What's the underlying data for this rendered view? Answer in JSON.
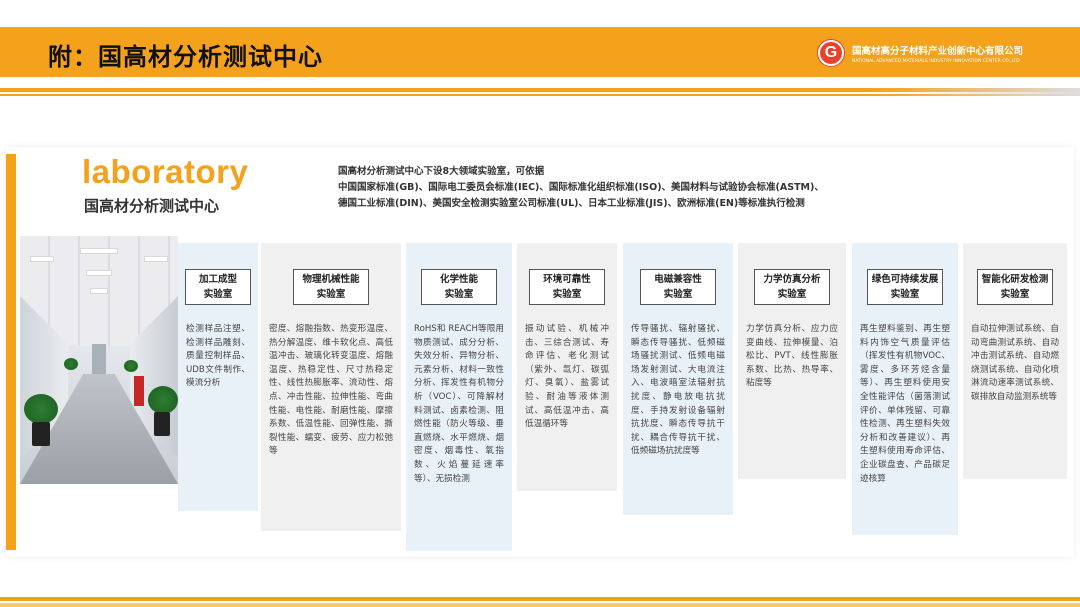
{
  "header": {
    "title": "附：国高材分析测试中心",
    "logo_letter": "G",
    "logo_cn": "国高材高分子材料产业创新中心有限公司",
    "logo_en": "NATIONAL ADVANCED MATERIALS INDUSTRY INNOVATION CENTER CO.,LTD"
  },
  "lab": {
    "heading": "laboratory",
    "subheading": "国高材分析测试中心"
  },
  "intro": {
    "line1": "国高材分析测试中心下设8大领域实验室，可依据",
    "line2": "中国国家标准(GB)、国际电工委员会标准(IEC)、国际标准化组织标准(ISO)、美国材料与试验协会标准(ASTM)、",
    "line3": "德国工业标准(DIN)、美国安全检测实验室公司标准(UL)、日本工业标准(JIS)、欧洲标准(EN)等标准执行检测"
  },
  "columns": [
    {
      "title1": "加工成型",
      "title2": "实验室",
      "body": "检测样品注塑、检测样品雕刻、质量控制样品、UDB文件制作、模流分析",
      "bg": "#e8f1f8"
    },
    {
      "title1": "物理机械性能",
      "title2": "实验室",
      "body": "密度、熔融指数、热变形温度、热分解温度、维卡软化点、高低温冲击、玻璃化转变温度、熔融温度、热稳定性、尺寸热稳定性、线性热膨胀率、流动性、熔点、冲击性能、拉伸性能、弯曲性能、电性能、耐磨性能、摩擦系数、低温性能、回弹性能、撕裂性能、蠕变、疲劳、应力松弛等",
      "bg": "#f0f0f0"
    },
    {
      "title1": "化学性能",
      "title2": "实验室",
      "body": "RoHS和 REACH等限用物质测试、成分分析、失效分析、异物分析、元素分析、材料一致性分析、挥发性有机物分析（VOC）、可降解材料测试、卤素检测、阻燃性能（防火等级、垂直燃烧、水平燃烧、烟密度、烟毒性、氧指数、火焰蔓延速率等）、无损检测",
      "bg": "#e8f1f8"
    },
    {
      "title1": "环境可靠性",
      "title2": "实验室",
      "body": "振动试验、机械冲击、三综合测试、寿命评估、老化测试（紫外、氙灯、碳弧灯、臭氧）、盐雾试验、耐油等液体测试、高低温冲击、高低温循环等",
      "bg": "#f0f0f0"
    },
    {
      "title1": "电磁兼容性",
      "title2": "实验室",
      "body": "传导骚扰、辐射骚扰、瞬态传导骚扰、低频磁场骚扰测试、低频电磁场发射测试、大电流注入、电波暗室法辐射抗扰度、静电放电抗扰度、手持发射设备辐射抗扰度、瞬态传导抗干扰、耦合传导抗干扰、低频磁场抗扰度等",
      "bg": "#e8f1f8"
    },
    {
      "title1": "力学仿真分析",
      "title2": "实验室",
      "body": "力学仿真分析、应力应变曲线、拉伸模量、泊松比、PVT、线性膨胀系数、比热、热导率、粘度等",
      "bg": "#f0f0f0"
    },
    {
      "title1": "绿色可持续发展",
      "title2": "实验室",
      "body": "再生塑料鉴别、再生塑料内饰空气质量评估（挥发性有机物VOC、雾度、多环芳烃含量等）、再生塑料使用安全性能评估（菌落测试评价、单体残留、可靠性检测、再生塑料失效分析和改善建议）、再生塑料使用寿命评估、企业碳盘查、产品碳足迹核算",
      "bg": "#e8f1f8"
    },
    {
      "title1": "智能化研发检测",
      "title2": "实验室",
      "body": "自动拉伸测试系统、自动弯曲测试系统、自动冲击测试系统、自动燃烧测试系统、自动化喷淋流动速率测试系统、碳排放自动监测系统等",
      "bg": "#f0f0f0"
    }
  ],
  "colors": {
    "accent": "#f4a11c",
    "logo_red": "#e8412c"
  }
}
